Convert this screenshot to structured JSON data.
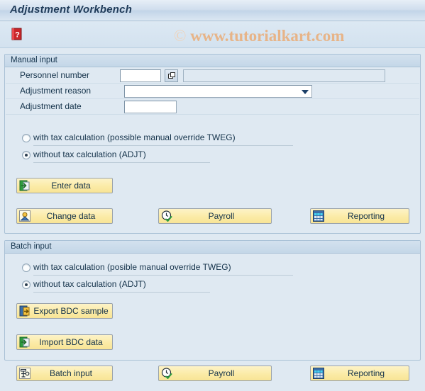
{
  "window": {
    "title": "Adjustment Workbench"
  },
  "toolbar": {
    "help_label": "Help",
    "help_icon": "help-book-icon"
  },
  "watermark": {
    "copyright_symbol": "©",
    "text": "www.tutorialkart.com",
    "color": "#e8b283"
  },
  "manual_input": {
    "group_title": "Manual input",
    "fields": [
      {
        "label": "Personnel number",
        "value": "",
        "placeholder": "",
        "has_match_code": true,
        "match_icon": "value-help-icon",
        "description_value": "",
        "description_readonly": true
      },
      {
        "label": "Adjustment reason",
        "value": "",
        "placeholder": "",
        "is_combo": true,
        "dropdown_icon": "chevron-down-icon"
      },
      {
        "label": "Adjustment date",
        "value": "",
        "placeholder": ""
      }
    ],
    "radio_group_name": "manual_tax_mode",
    "radios": [
      {
        "label": "with tax calculation (possible manual override TWEG)",
        "selected": false
      },
      {
        "label": "without tax calculation (ADJT)",
        "selected": true
      }
    ],
    "primary_button": {
      "label": "Enter data",
      "icon": "enter-data-icon"
    },
    "action_buttons": [
      {
        "label": "Change data",
        "icon": "person-icon"
      },
      {
        "label": "Payroll",
        "icon": "clock-check-icon"
      },
      {
        "label": "Reporting",
        "icon": "grid-report-icon"
      }
    ]
  },
  "batch_input": {
    "group_title": "Batch input",
    "radio_group_name": "batch_tax_mode",
    "radios": [
      {
        "label": "with tax calculation (posible manual override TWEG)",
        "selected": false
      },
      {
        "label": "without tax calculation (ADJT)",
        "selected": true
      }
    ],
    "export_button": {
      "label": "Export BDC sample",
      "icon": "export-bdc-icon"
    },
    "import_button": {
      "label": "Import BDC data",
      "icon": "import-bdc-icon"
    },
    "action_buttons": [
      {
        "label": "Batch input",
        "icon": "batch-input-icon"
      },
      {
        "label": "Payroll",
        "icon": "clock-check-icon"
      },
      {
        "label": "Reporting",
        "icon": "grid-report-icon"
      }
    ]
  },
  "colors": {
    "background": "#dfe9f2",
    "title_text": "#1f3b59",
    "button_face": "#fbeba6",
    "group_border": "#a9c1d6",
    "watermark": "#e8b283"
  }
}
